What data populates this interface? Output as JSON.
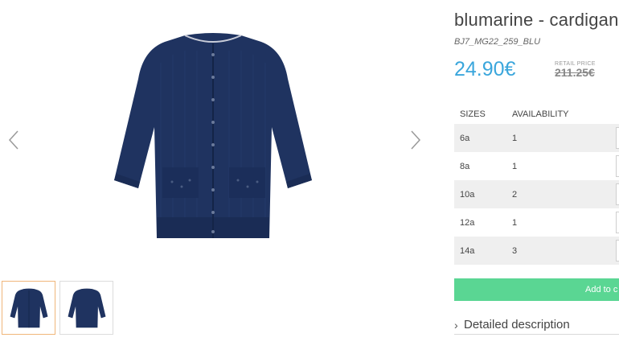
{
  "product": {
    "title": "blumarine - cardigan l",
    "sku": "BJ7_MG22_259_BLU",
    "price": "24.90€",
    "retail_label": "RETAIL PRICE",
    "retail_price": "211.25€"
  },
  "sizes_table": {
    "headers": {
      "size": "SIZES",
      "availability": "AVAILABILITY"
    },
    "rows": [
      {
        "size": "6a",
        "availability": "1"
      },
      {
        "size": "8a",
        "availability": "1"
      },
      {
        "size": "10a",
        "availability": "2"
      },
      {
        "size": "12a",
        "availability": "1"
      },
      {
        "size": "14a",
        "availability": "3"
      }
    ]
  },
  "cart": {
    "add_label": "Add to c"
  },
  "details": {
    "label": "Detailed description"
  },
  "colors": {
    "price": "#3aa6dc",
    "cart_button": "#5ad693",
    "garment": "#1f3360"
  },
  "icons": {
    "prev": "chevron-left-icon",
    "next": "chevron-right-icon",
    "details": "chevron-right-icon"
  }
}
